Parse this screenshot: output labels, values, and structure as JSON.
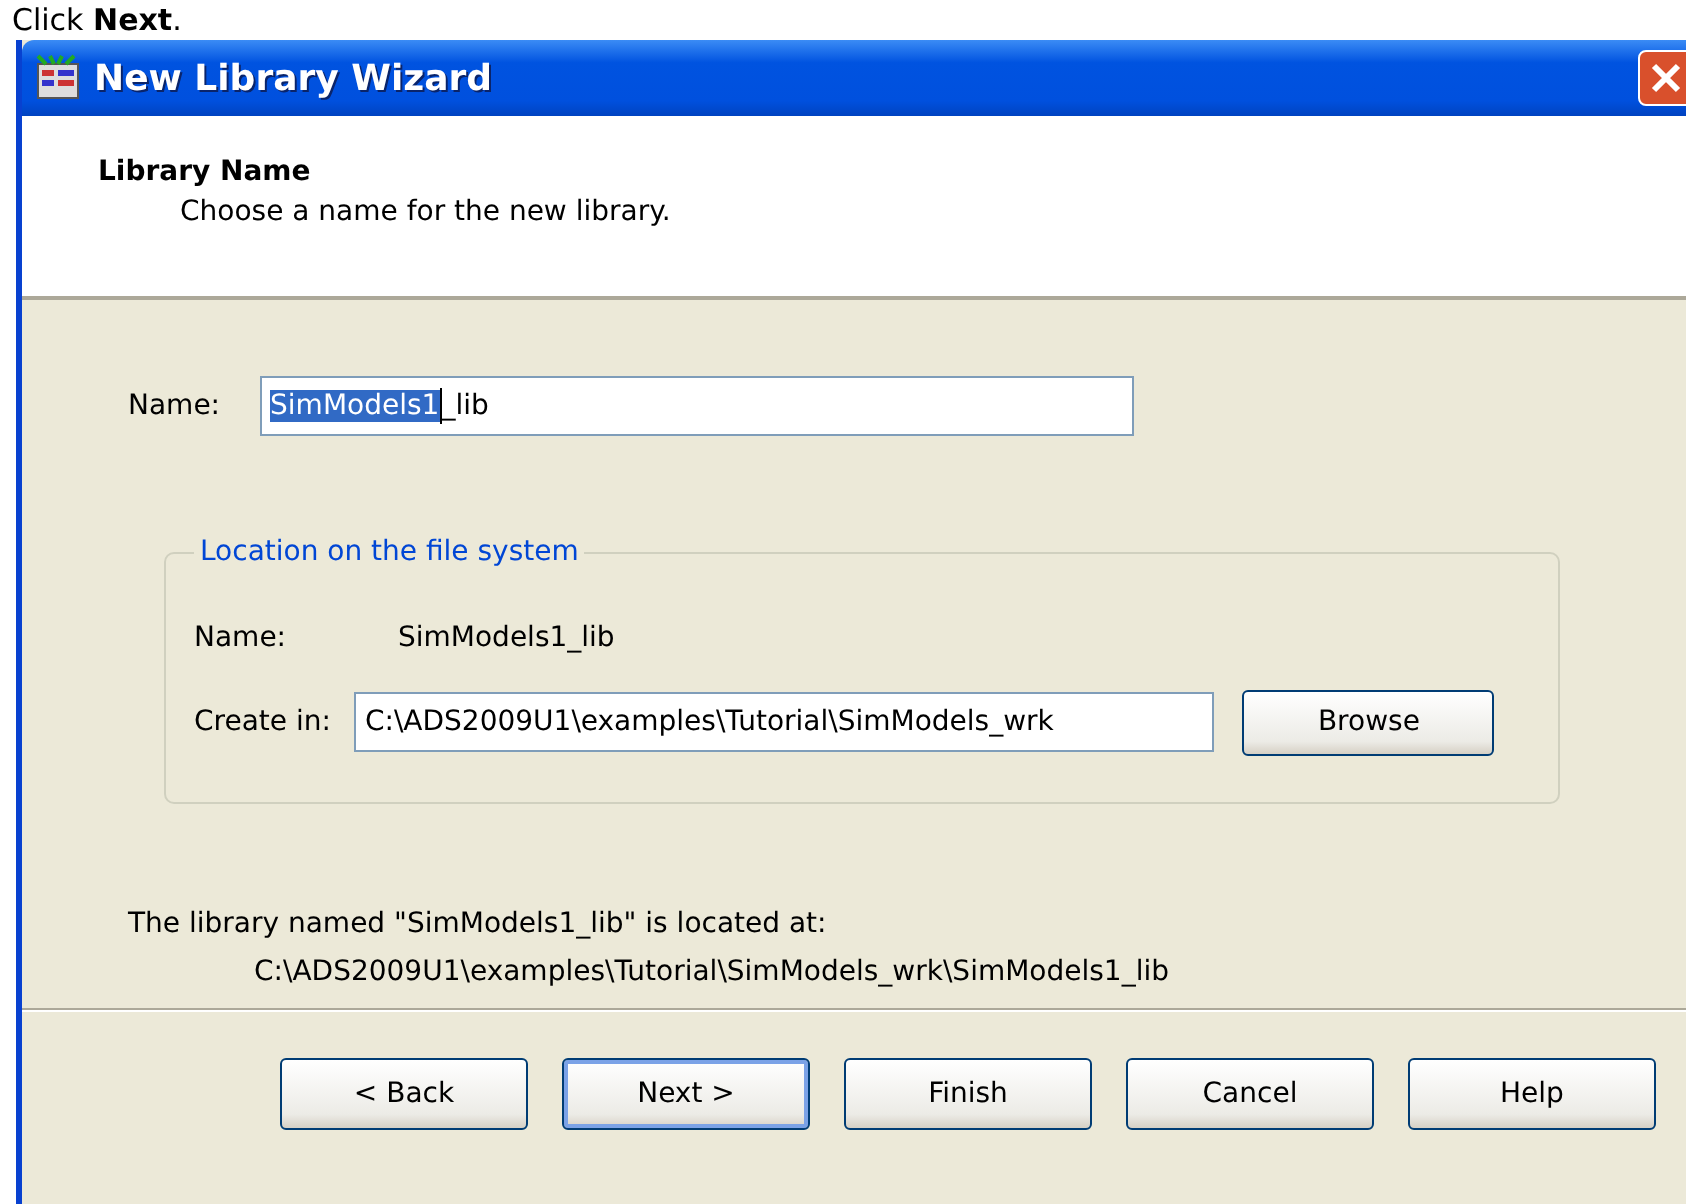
{
  "caption": "Click **Next**.",
  "window": {
    "title": "New Library Wizard"
  },
  "header": {
    "title": "Library Name",
    "subtitle": "Choose a name for the new library."
  },
  "name_field": {
    "label": "Name:",
    "value_selected": "SimModels1",
    "value_rest": "_lib"
  },
  "location_group": {
    "legend": "Location on the file system",
    "name_label": "Name:",
    "name_value": "SimModels1_lib",
    "create_label": "Create in:",
    "create_value": "C:\\ADS2009U1\\examples\\Tutorial\\SimModels_wrk",
    "browse_button": "Browse"
  },
  "summary": {
    "line1": "The library named \"SimModels1_lib\" is located at:",
    "line2": "C:\\ADS2009U1\\examples\\Tutorial\\SimModels_wrk\\SimModels1_lib"
  },
  "buttons": [
    {
      "label": "< Back",
      "default": false
    },
    {
      "label": "Next >",
      "default": true
    },
    {
      "label": "Finish",
      "default": false
    },
    {
      "label": "Cancel",
      "default": false
    },
    {
      "label": "Help",
      "default": false
    }
  ]
}
